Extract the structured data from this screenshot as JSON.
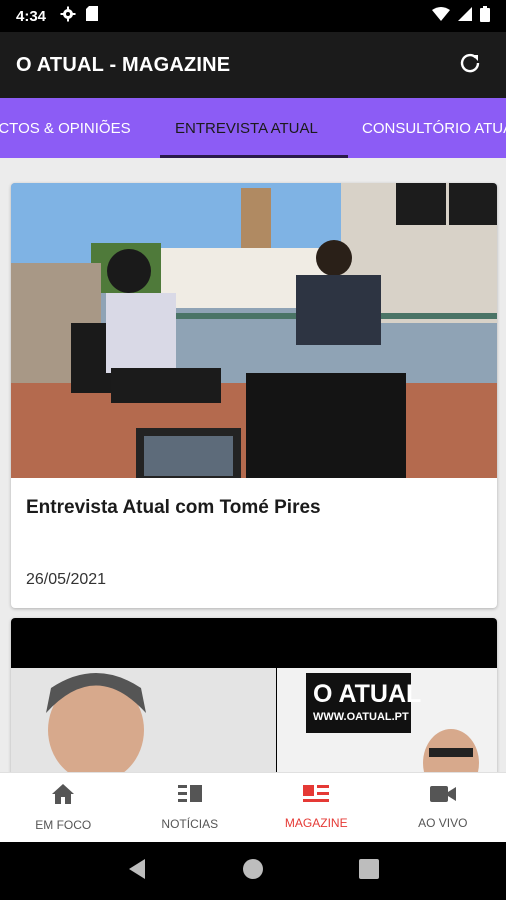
{
  "status_bar": {
    "time": "4:34"
  },
  "app_bar": {
    "title": "O ATUAL - MAGAZINE"
  },
  "tabs": [
    {
      "label": "FACTOS & OPINIÕES",
      "active": false
    },
    {
      "label": "ENTREVISTA ATUAL",
      "active": true
    },
    {
      "label": "CONSULTÓRIO ATUAL",
      "active": false
    }
  ],
  "cards": [
    {
      "title": "Entrevista Atual com Tomé Pires",
      "date": "26/05/2021"
    },
    {
      "logo_text": "O ATUAL",
      "logo_url": "WWW.OATUAL.PT"
    }
  ],
  "bottom_nav": [
    {
      "label": "EM FOCO",
      "icon": "home-icon",
      "active": false
    },
    {
      "label": "NOTÍCIAS",
      "icon": "news-icon",
      "active": false
    },
    {
      "label": "MAGAZINE",
      "icon": "magazine-icon",
      "active": true
    },
    {
      "label": "AO VIVO",
      "icon": "video-camera-icon",
      "active": false
    }
  ],
  "colors": {
    "accent": "#8c5cf5",
    "active_nav": "#e53935",
    "app_bar": "#1b1b1b"
  }
}
